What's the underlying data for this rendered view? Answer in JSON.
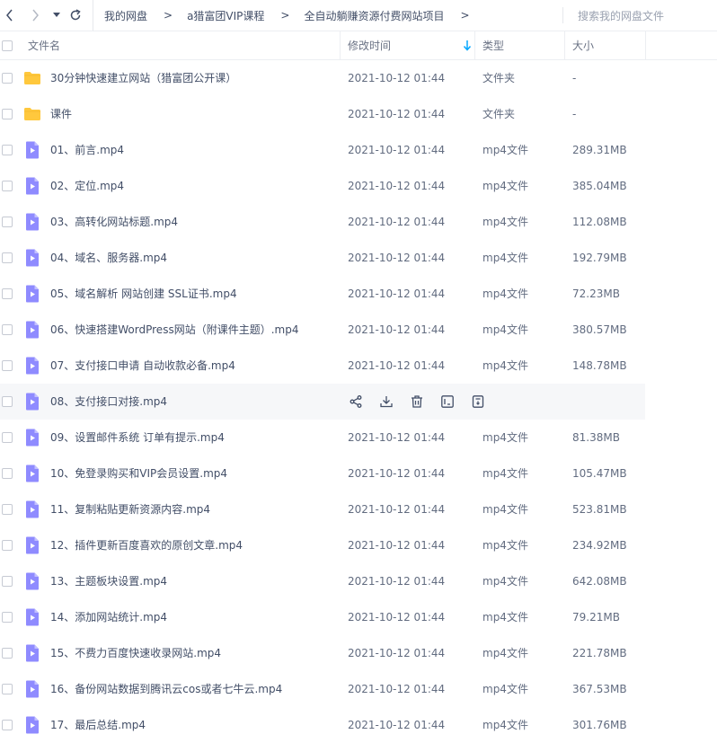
{
  "nav": {
    "back_icon": "chevron-left-icon",
    "forward_icon": "chevron-right-icon",
    "dropdown_icon": "caret-down-icon",
    "refresh_icon": "refresh-icon"
  },
  "breadcrumb": [
    "我的网盘",
    "a猎富团VIP课程",
    "全自动躺赚资源付费网站项目"
  ],
  "breadcrumb_separator": ">",
  "search": {
    "placeholder": "搜索我的网盘文件"
  },
  "columns": {
    "name": "文件名",
    "modified": "修改时间",
    "type": "类型",
    "size": "大小",
    "sort_icon": "arrow-down-icon"
  },
  "colors": {
    "accent": "#06a7ff",
    "folder": "#ffc83d",
    "video": "#8f8bff",
    "text": "#424e67",
    "hover_row": "#f6f7f9"
  },
  "hover_actions": [
    "share-icon",
    "download-icon",
    "delete-icon",
    "subtitle-icon",
    "more-icon"
  ],
  "files": [
    {
      "name": "30分钟快速建立网站（猎富团公开课）",
      "date": "2021-10-12 01:44",
      "type": "文件夹",
      "size": "-",
      "icon": "folder-icon"
    },
    {
      "name": "课件",
      "date": "2021-10-12 01:44",
      "type": "文件夹",
      "size": "-",
      "icon": "folder-icon"
    },
    {
      "name": "01、前言.mp4",
      "date": "2021-10-12 01:44",
      "type": "mp4文件",
      "size": "289.31MB",
      "icon": "video-file-icon"
    },
    {
      "name": "02、定位.mp4",
      "date": "2021-10-12 01:44",
      "type": "mp4文件",
      "size": "385.04MB",
      "icon": "video-file-icon"
    },
    {
      "name": "03、高转化网站标题.mp4",
      "date": "2021-10-12 01:44",
      "type": "mp4文件",
      "size": "112.08MB",
      "icon": "video-file-icon"
    },
    {
      "name": "04、域名、服务器.mp4",
      "date": "2021-10-12 01:44",
      "type": "mp4文件",
      "size": "192.79MB",
      "icon": "video-file-icon"
    },
    {
      "name": "05、域名解析 网站创建 SSL证书.mp4",
      "date": "2021-10-12 01:44",
      "type": "mp4文件",
      "size": "72.23MB",
      "icon": "video-file-icon"
    },
    {
      "name": "06、快速搭建WordPress网站（附课件主题）.mp4",
      "date": "2021-10-12 01:44",
      "type": "mp4文件",
      "size": "380.57MB",
      "icon": "video-file-icon"
    },
    {
      "name": "07、支付接口申请 自动收款必备.mp4",
      "date": "2021-10-12 01:44",
      "type": "mp4文件",
      "size": "148.78MB",
      "icon": "video-file-icon"
    },
    {
      "name": "08、支付接口对接.mp4",
      "date": "",
      "type": "",
      "size": "",
      "icon": "video-file-icon",
      "hovered": true
    },
    {
      "name": "09、设置邮件系统 订单有提示.mp4",
      "date": "2021-10-12 01:44",
      "type": "mp4文件",
      "size": "81.38MB",
      "icon": "video-file-icon"
    },
    {
      "name": "10、免登录购买和VIP会员设置.mp4",
      "date": "2021-10-12 01:44",
      "type": "mp4文件",
      "size": "105.47MB",
      "icon": "video-file-icon"
    },
    {
      "name": "11、复制粘贴更新资源内容.mp4",
      "date": "2021-10-12 01:44",
      "type": "mp4文件",
      "size": "523.81MB",
      "icon": "video-file-icon"
    },
    {
      "name": "12、插件更新百度喜欢的原创文章.mp4",
      "date": "2021-10-12 01:44",
      "type": "mp4文件",
      "size": "234.92MB",
      "icon": "video-file-icon"
    },
    {
      "name": "13、主题板块设置.mp4",
      "date": "2021-10-12 01:44",
      "type": "mp4文件",
      "size": "642.08MB",
      "icon": "video-file-icon"
    },
    {
      "name": "14、添加网站统计.mp4",
      "date": "2021-10-12 01:44",
      "type": "mp4文件",
      "size": "79.21MB",
      "icon": "video-file-icon"
    },
    {
      "name": "15、不费力百度快速收录网站.mp4",
      "date": "2021-10-12 01:44",
      "type": "mp4文件",
      "size": "221.78MB",
      "icon": "video-file-icon"
    },
    {
      "name": "16、备份网站数据到腾讯云cos或者七牛云.mp4",
      "date": "2021-10-12 01:44",
      "type": "mp4文件",
      "size": "367.53MB",
      "icon": "video-file-icon"
    },
    {
      "name": "17、最后总结.mp4",
      "date": "2021-10-12 01:44",
      "type": "mp4文件",
      "size": "301.76MB",
      "icon": "video-file-icon"
    }
  ]
}
